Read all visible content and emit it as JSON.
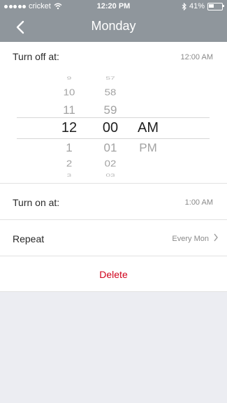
{
  "status": {
    "carrier": "cricket",
    "time": "12:20 PM",
    "battery": "41%"
  },
  "header": {
    "title": "Monday"
  },
  "off": {
    "label": "Turn off at:",
    "value": "12:00 AM"
  },
  "picker": {
    "hours": [
      "9",
      "10",
      "11",
      "12",
      "1",
      "2",
      "3"
    ],
    "minutes": [
      "57",
      "58",
      "59",
      "00",
      "01",
      "02",
      "03"
    ],
    "period": [
      "AM",
      "PM"
    ]
  },
  "on": {
    "label": "Turn on at:",
    "value": "1:00 AM"
  },
  "repeat": {
    "label": "Repeat",
    "value": "Every Mon"
  },
  "delete_label": "Delete",
  "colors": {
    "header": "#8f969c",
    "delete": "#d0021b",
    "background": "#ecedf2"
  }
}
